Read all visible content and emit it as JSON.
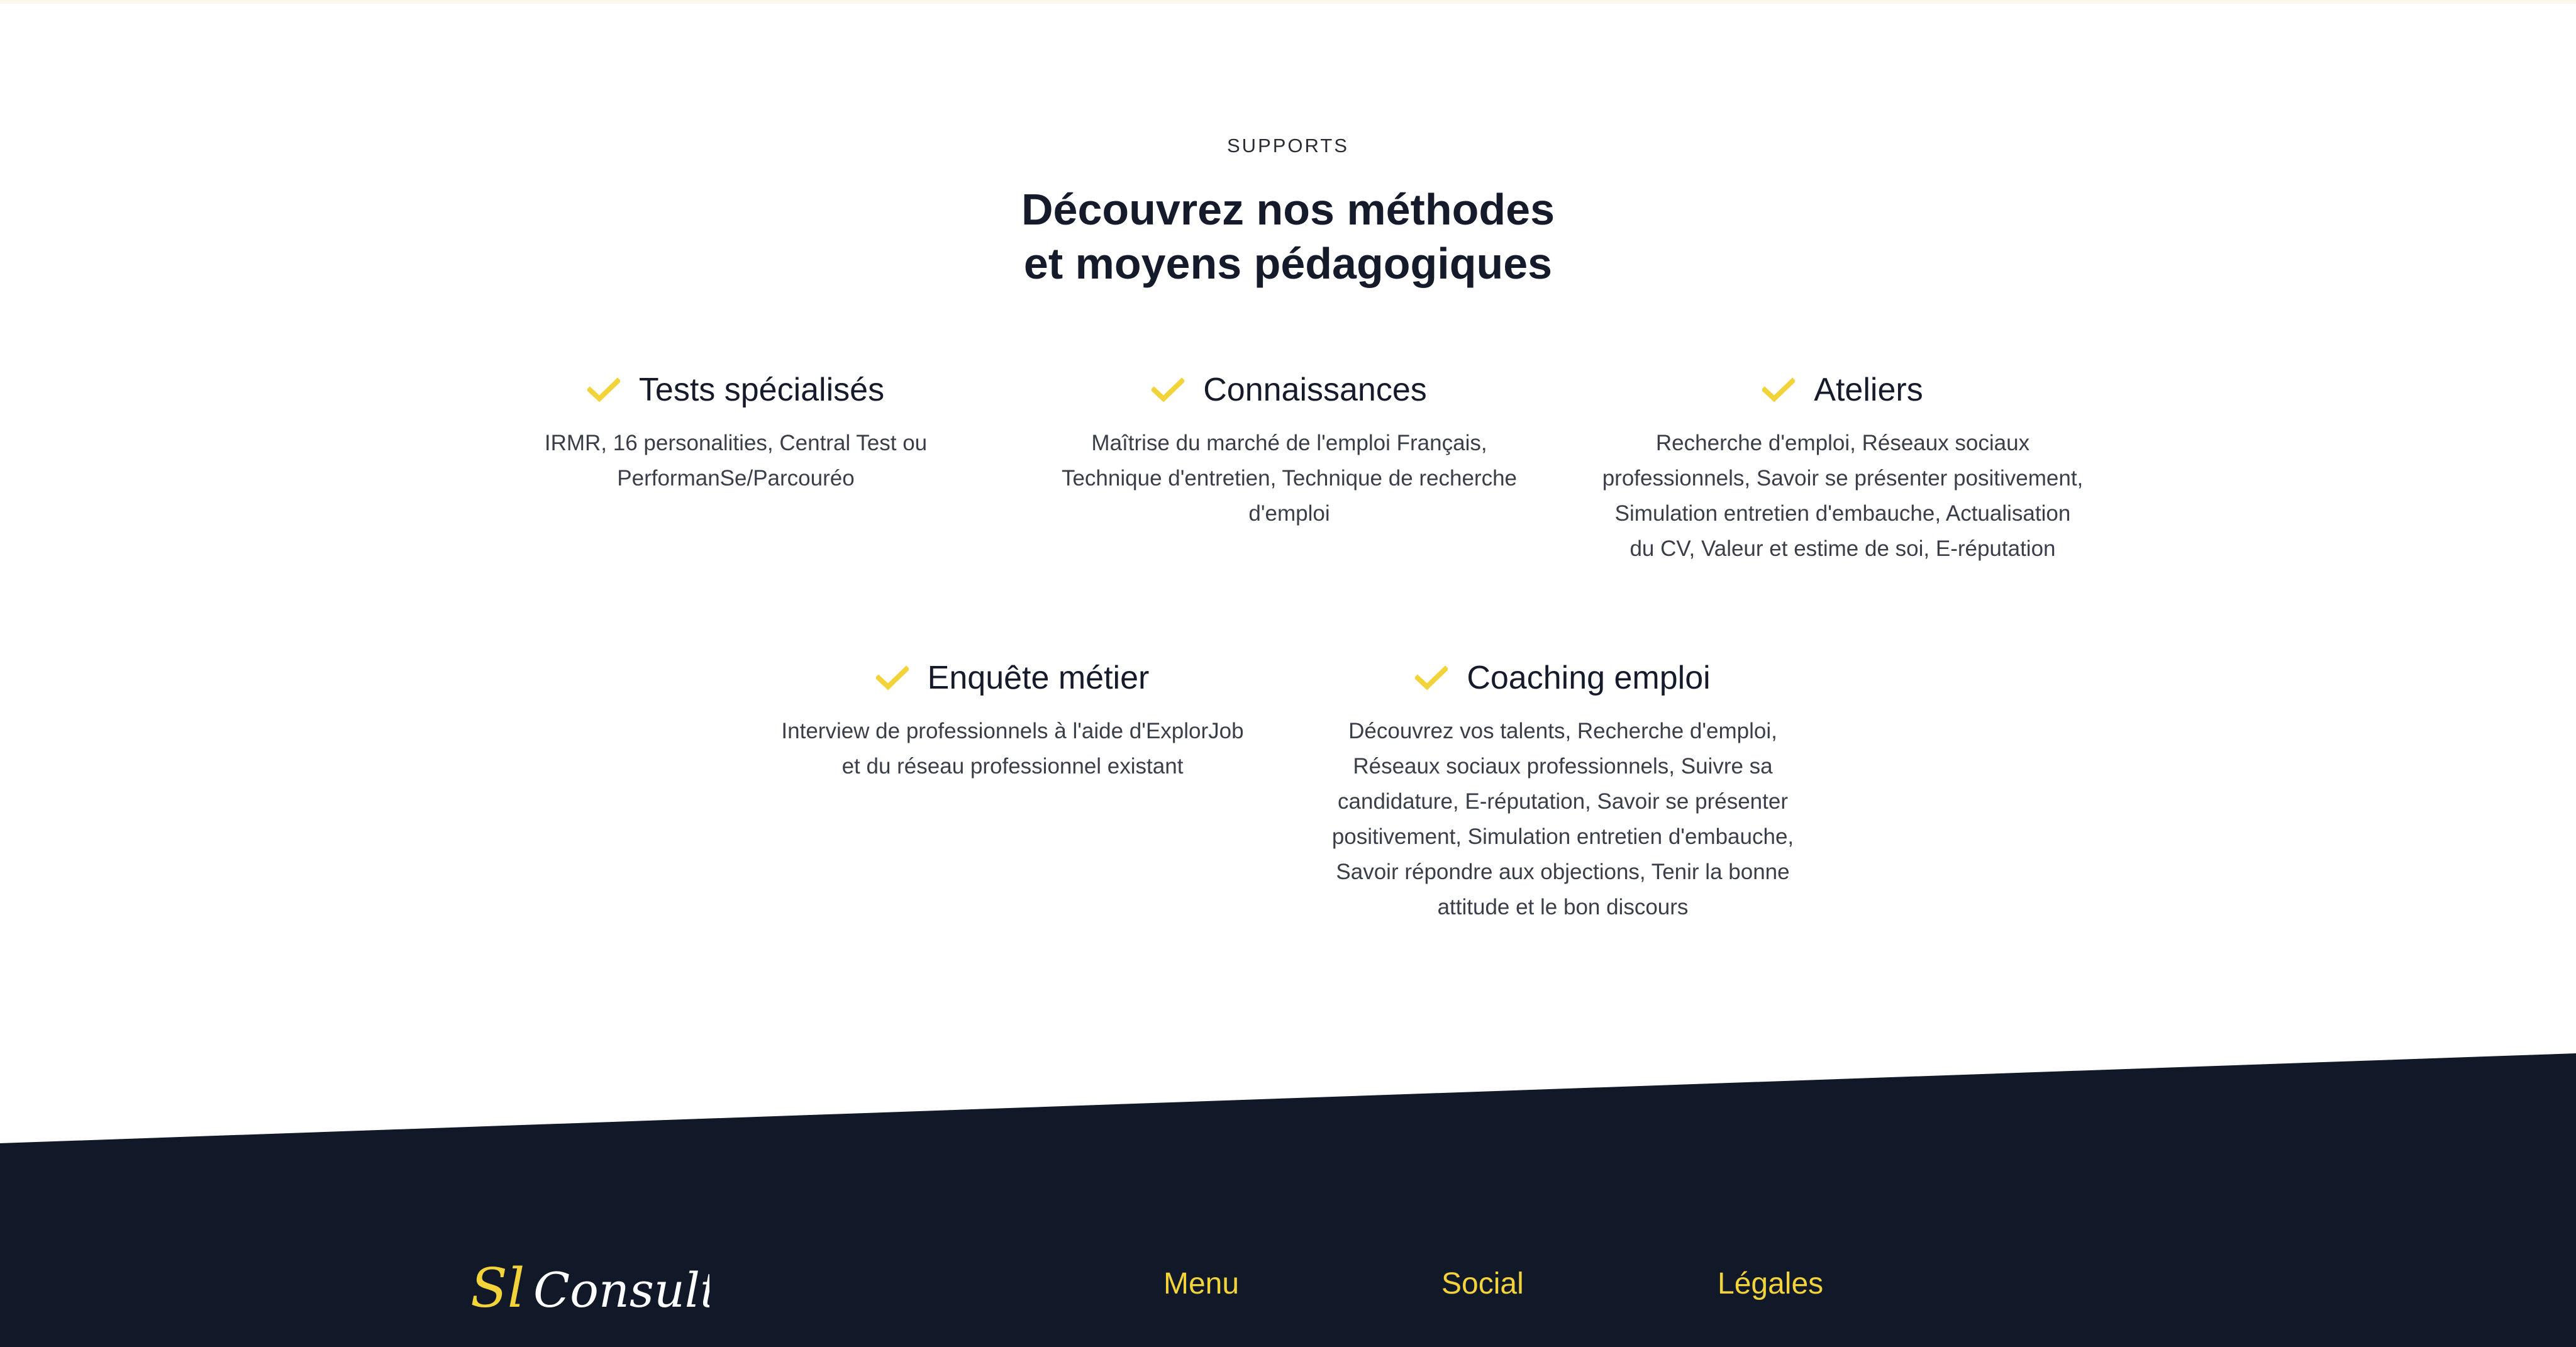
{
  "section": {
    "eyebrow": "SUPPORTS",
    "headline_line1": "Découvrez nos méthodes",
    "headline_line2": "et moyens pédagogiques"
  },
  "features": [
    {
      "icon": "check-icon",
      "title": "Tests spécialisés",
      "text_lines": [
        "IRMR, 16 personalities, Central Test ou",
        "PerformanSe/Parcouréo"
      ]
    },
    {
      "icon": "check-icon",
      "title": "Connaissances",
      "text_lines": [
        "Maîtrise du marché de l'emploi Français,",
        "Technique d'entretien, Technique de recherche",
        "d'emploi"
      ]
    },
    {
      "icon": "check-icon",
      "title": "Ateliers",
      "text_lines": [
        "Recherche d'emploi, Réseaux sociaux",
        "professionnels, Savoir se présenter positivement,",
        "Simulation entretien d'embauche, Actualisation",
        "du CV, Valeur et estime de soi, E-réputation"
      ]
    },
    {
      "icon": "check-icon",
      "title": "Enquête métier",
      "text_lines": [
        "Interview de professionnels à l'aide d'ExplorJob",
        "et du réseau professionnel  existant"
      ]
    },
    {
      "icon": "check-icon",
      "title": "Coaching emploi",
      "text_lines": [
        "Découvrez vos talents, Recherche d'emploi,",
        "Réseaux sociaux professionnels, Suivre sa",
        "candidature, E-réputation, Savoir se présenter",
        "positivement, Simulation entretien d'embauche,",
        "Savoir répondre aux objections, Tenir la bonne",
        "attitude et le bon discours"
      ]
    }
  ],
  "footer": {
    "logo_initials": "Sl",
    "logo_word": "Consulting",
    "menu_title": "Menu",
    "social_title": "Social",
    "legal_title": "Légales"
  },
  "colors": {
    "accent": "#f2d33a",
    "footer_bg": "#111827",
    "heading": "#161b2c"
  }
}
